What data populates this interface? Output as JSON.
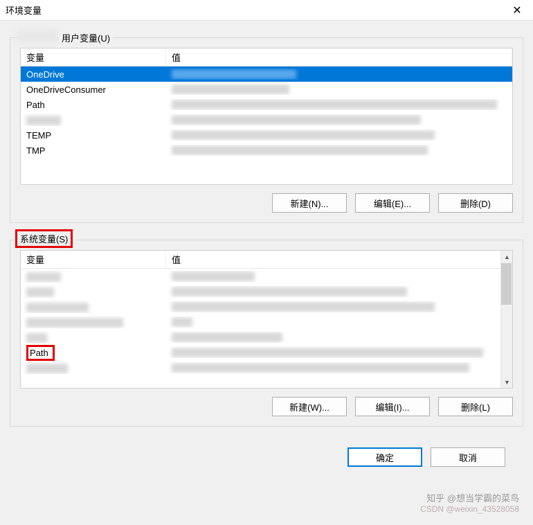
{
  "window": {
    "title": "环境变量",
    "close_glyph": "✕"
  },
  "user_section": {
    "label_suffix": "用户变量(U)",
    "columns": {
      "variable": "变量",
      "value": "值"
    },
    "rows": [
      {
        "name": "OneDrive",
        "selected": true
      },
      {
        "name": "OneDriveConsumer",
        "selected": false
      },
      {
        "name": "Path",
        "selected": false
      },
      {
        "name": "",
        "selected": false,
        "blurred": true
      },
      {
        "name": "TEMP",
        "selected": false
      },
      {
        "name": "TMP",
        "selected": false
      }
    ],
    "buttons": {
      "new": "新建(N)...",
      "edit": "编辑(E)...",
      "delete": "删除(D)"
    }
  },
  "system_section": {
    "label": "系统变量(S)",
    "columns": {
      "variable": "变量",
      "value": "值"
    },
    "path_row_label": "Path",
    "buttons": {
      "new": "新建(W)...",
      "edit": "编辑(I)...",
      "delete": "删除(L)"
    }
  },
  "dialog_buttons": {
    "ok": "确定",
    "cancel": "取消"
  },
  "watermark": {
    "line1": "知乎 @想当学霸的菜鸟",
    "line2": "CSDN @weixin_43528058"
  }
}
